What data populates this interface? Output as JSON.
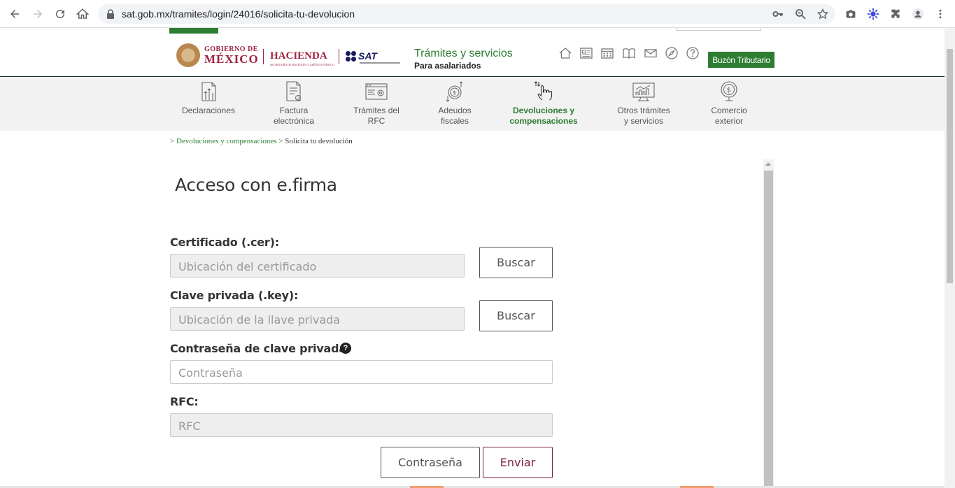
{
  "browser": {
    "url": "sat.gob.mx/tramites/login/24016/solicita-tu-devolucion"
  },
  "header": {
    "gob_line1": "GOBIERNO DE",
    "gob_line2": "MÉXICO",
    "hacienda": "HACIENDA",
    "hacienda_sub": "SECRETARÍA DE HACIENDA Y CRÉDITO PÚBLICO",
    "sat": "SAT",
    "section_title": "Trámites y servicios",
    "section_sub": "Para asalariados",
    "icons": [
      "home-icon",
      "newspaper-icon",
      "calendar-icon",
      "book-icon",
      "mail-icon",
      "compass-icon",
      "help-icon"
    ],
    "buzon": "Buzón Tributario"
  },
  "nav": {
    "items": [
      {
        "label1": "Declaraciones",
        "label2": "",
        "icon": "declaraciones-icon"
      },
      {
        "label1": "Factura",
        "label2": "electrónica",
        "icon": "factura-icon"
      },
      {
        "label1": "Trámites del",
        "label2": "RFC",
        "icon": "rfc-icon"
      },
      {
        "label1": "Adeudos",
        "label2": "fiscales",
        "icon": "adeudos-icon"
      },
      {
        "label1": "Devoluciones y",
        "label2": "compensaciones",
        "icon": "devoluciones-icon"
      },
      {
        "label1": "Otros trámites",
        "label2": "y servicios",
        "icon": "otros-icon"
      },
      {
        "label1": "Comercio",
        "label2": "exterior",
        "icon": "comercio-icon"
      }
    ],
    "active_index": 4
  },
  "breadcrumb": {
    "sep1": ">",
    "link": "Devoluciones y compensaciones",
    "sep2": ">",
    "current": "Solicita tu devolución"
  },
  "form": {
    "title": "Acceso con e.firma",
    "cert_label": "Certificado (.cer):",
    "cert_placeholder": "Ubicación del certificado",
    "cert_button": "Buscar",
    "key_label": "Clave privada (.key):",
    "key_placeholder": "Ubicación de la llave privada",
    "key_button": "Buscar",
    "password_label": "Contraseña de clave privada:",
    "password_help": "?",
    "password_placeholder": "Contraseña",
    "rfc_label": "RFC:",
    "rfc_placeholder": "RFC",
    "btn_contrasena": "Contraseña",
    "btn_enviar": "Enviar"
  },
  "colors": {
    "green": "#2e7d32",
    "guinda": "#9f2241",
    "enviar_border": "#7a1c3c"
  }
}
